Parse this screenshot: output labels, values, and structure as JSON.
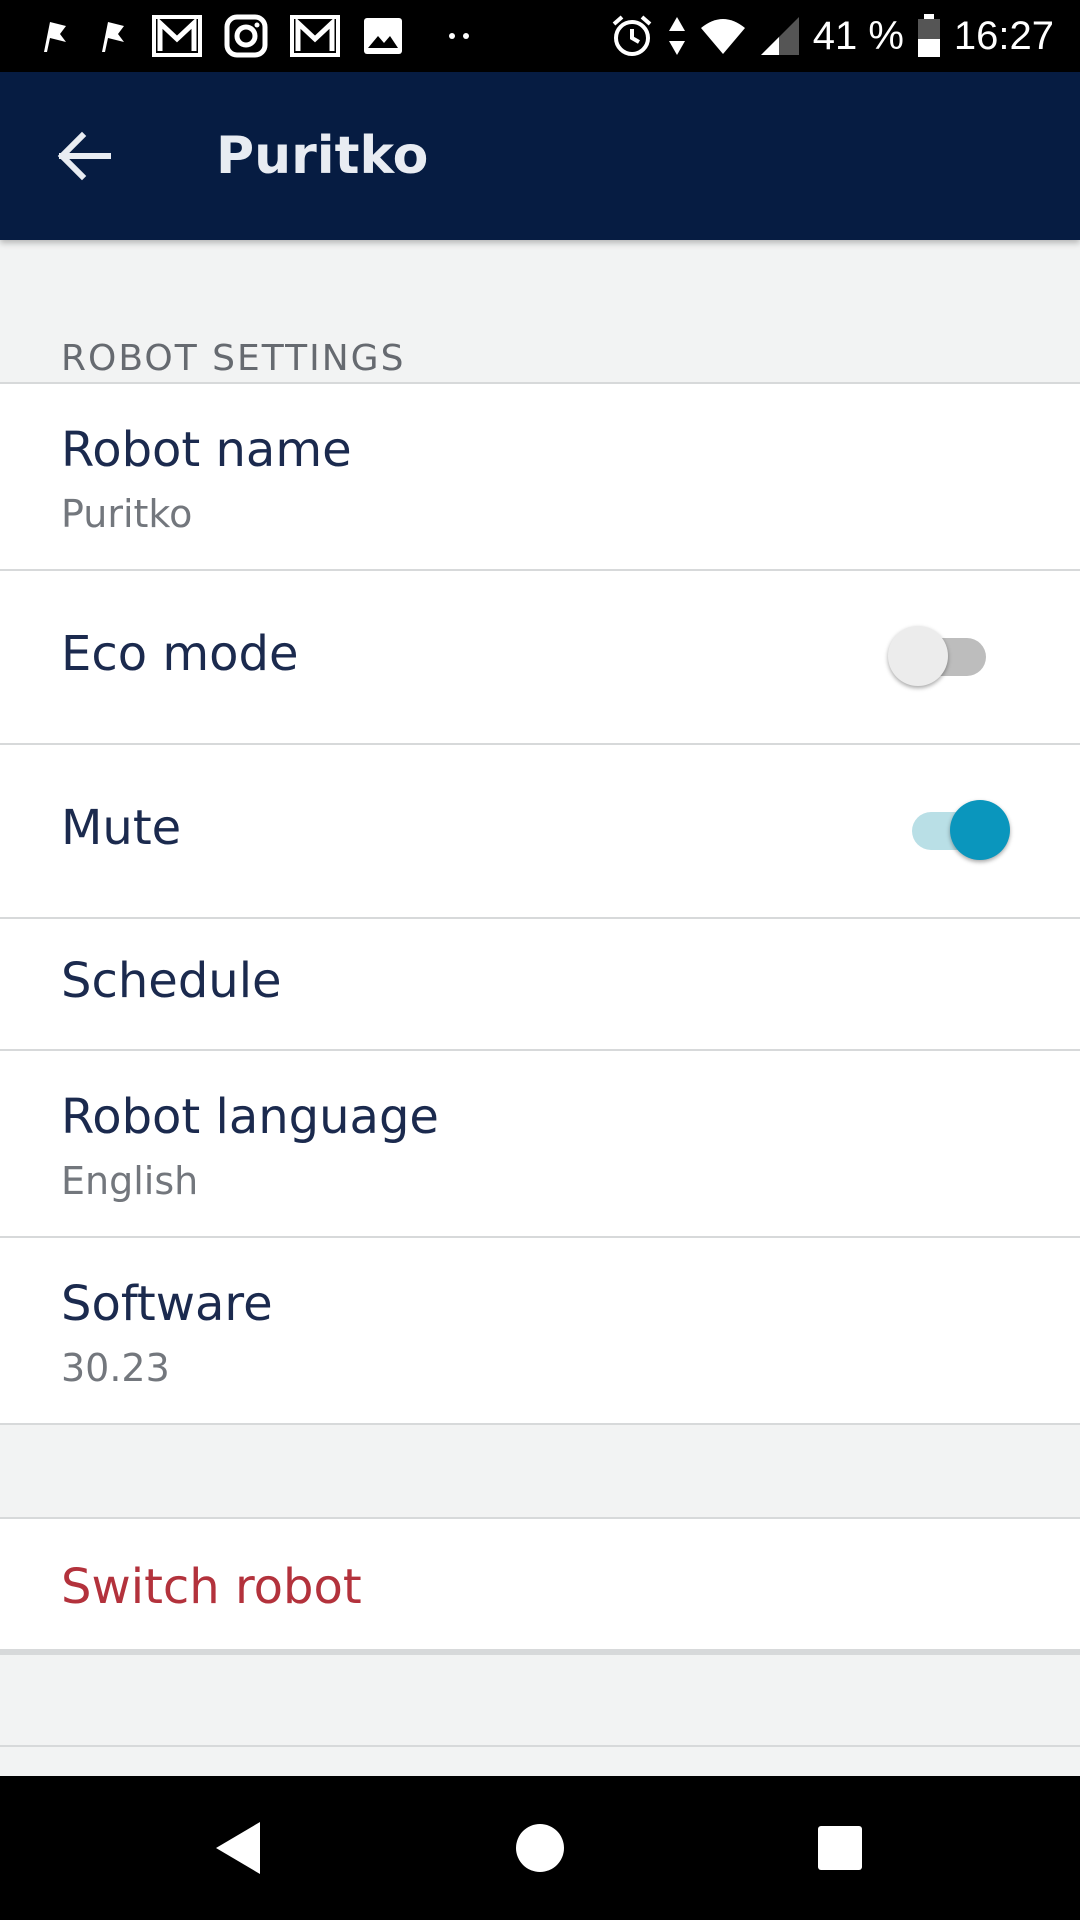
{
  "status_bar": {
    "battery": "41 %",
    "time": "16:27",
    "left_icons": [
      "flag-icon",
      "flag-icon",
      "gmail-icon",
      "instagram-icon",
      "gmail-icon",
      "gallery-icon",
      "more-dots-icon"
    ],
    "right_icons": [
      "alarm-icon",
      "data-arrows-icon",
      "wifi-icon",
      "signal-icon",
      "battery-icon"
    ]
  },
  "app_bar": {
    "back_icon": "arrow-left-icon",
    "title": "Puritko",
    "background": "#061c42"
  },
  "section": {
    "header": "ROBOT SETTINGS"
  },
  "settings": {
    "robot_name": {
      "title": "Robot name",
      "value": "Puritko"
    },
    "eco_mode": {
      "title": "Eco mode",
      "enabled": false
    },
    "mute": {
      "title": "Mute",
      "enabled": true
    },
    "schedule": {
      "title": "Schedule"
    },
    "robot_language": {
      "title": "Robot language",
      "value": "English"
    },
    "software": {
      "title": "Software",
      "value": "30.23"
    }
  },
  "actions": {
    "switch_robot": "Switch robot"
  },
  "colors": {
    "accent": "#0a96bd",
    "destructive": "#b3323c",
    "text": "#1b2a4e"
  },
  "nav_bar": {
    "buttons": [
      "nav-back-icon",
      "nav-home-icon",
      "nav-recents-icon"
    ]
  }
}
